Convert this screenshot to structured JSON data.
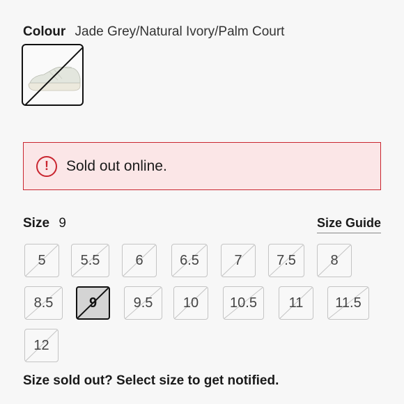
{
  "colour": {
    "label": "Colour",
    "value": "Jade Grey/Natural Ivory/Palm Court"
  },
  "swatch": {
    "icon": "sneaker-thumbnail"
  },
  "alert": {
    "icon": "exclamation-circle-icon",
    "icon_glyph": "!",
    "text": "Sold out online.",
    "color": "#c9252f"
  },
  "size": {
    "label": "Size",
    "selected": "9",
    "guide_label": "Size Guide"
  },
  "sizes": [
    {
      "label": "5",
      "selected": false
    },
    {
      "label": "5.5",
      "selected": false
    },
    {
      "label": "6",
      "selected": false
    },
    {
      "label": "6.5",
      "selected": false
    },
    {
      "label": "7",
      "selected": false
    },
    {
      "label": "7.5",
      "selected": false
    },
    {
      "label": "8",
      "selected": false
    },
    {
      "label": "8.5",
      "selected": false
    },
    {
      "label": "9",
      "selected": true
    },
    {
      "label": "9.5",
      "selected": false
    },
    {
      "label": "10",
      "selected": false
    },
    {
      "label": "10.5",
      "selected": false
    },
    {
      "label": "11",
      "selected": false
    },
    {
      "label": "11.5",
      "selected": false
    },
    {
      "label": "12",
      "selected": false
    }
  ],
  "footer": {
    "note": "Size sold out? Select size to get notified."
  }
}
